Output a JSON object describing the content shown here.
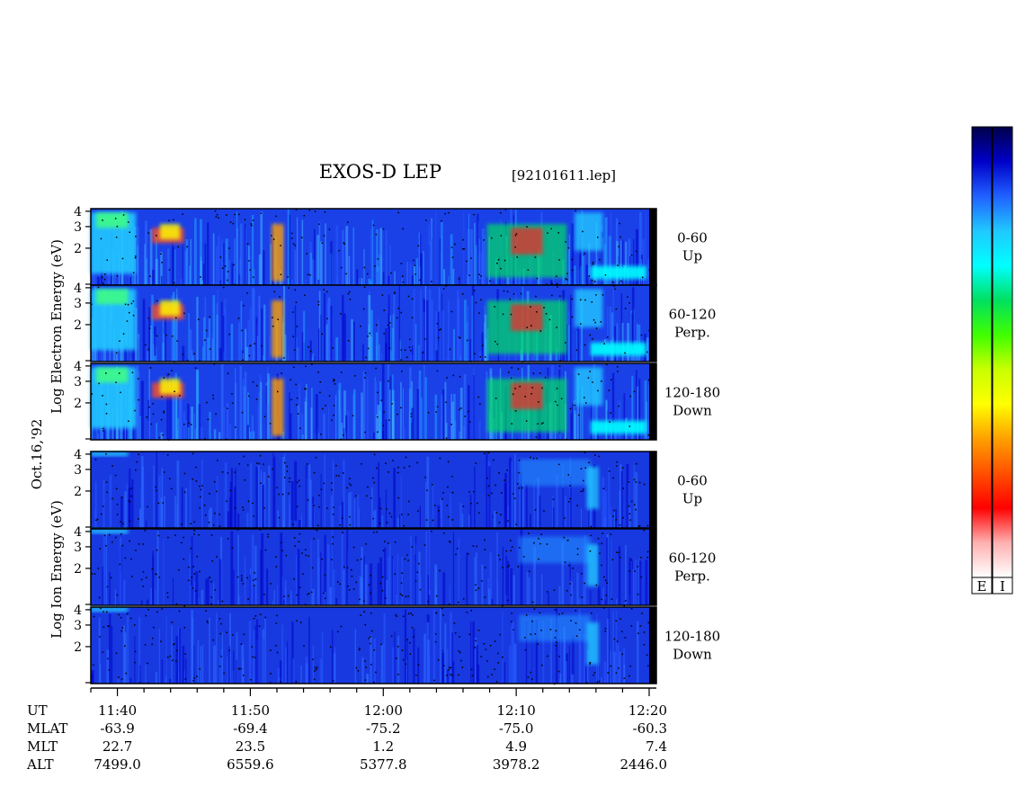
{
  "header": {
    "title": "EXOS-D LEP",
    "file_id": "[92101611.lep]"
  },
  "date_label": "Oct.16,'92",
  "chart_data": {
    "type": "heatmap",
    "x_axis": {
      "quantity": "UT",
      "range": [
        "11:38",
        "12:20"
      ],
      "tick_labels": [
        "11:40",
        "11:50",
        "12:00",
        "12:10",
        "12:20"
      ],
      "minor_tick_interval_min": 2
    },
    "y_axis": {
      "scale": "log",
      "tick_labels": [
        "2",
        "3",
        "4"
      ],
      "range": [
        1,
        4.2
      ]
    },
    "groups": [
      {
        "id": "electron",
        "ylabel": "Log Electron Energy (eV)",
        "panels": [
          {
            "label_line1": "0-60",
            "label_line2": "Up"
          },
          {
            "label_line1": "60-120",
            "label_line2": "Perp."
          },
          {
            "label_line1": "120-180",
            "label_line2": "Down"
          }
        ]
      },
      {
        "id": "ion",
        "ylabel": "Log Ion Energy (eV)",
        "panels": [
          {
            "label_line1": "0-60",
            "label_line2": "Up"
          },
          {
            "label_line1": "60-120",
            "label_line2": "Perp."
          },
          {
            "label_line1": "120-180",
            "label_line2": "Down"
          }
        ]
      }
    ],
    "ephemeris": {
      "rows": [
        {
          "name": "UT",
          "values": [
            "11:40",
            "11:50",
            "12:00",
            "12:10",
            "12:20"
          ]
        },
        {
          "name": "MLAT",
          "values": [
            "-63.9",
            "-69.4",
            "-75.2",
            "-75.0",
            "-60.3"
          ]
        },
        {
          "name": "MLT",
          "values": [
            "22.7",
            "23.5",
            "1.2",
            "4.9",
            "7.4"
          ]
        },
        {
          "name": "ALT",
          "values": [
            "7499.0",
            "6559.6",
            "5377.8",
            "3978.2",
            "2446.0"
          ]
        }
      ]
    },
    "colorbars": [
      {
        "label": "E",
        "colors": [
          "#00004a",
          "#0000c8",
          "#2060ff",
          "#20c8ff",
          "#00ffff",
          "#00e060",
          "#40ff00",
          "#c8ff00",
          "#ffff00",
          "#ffa000",
          "#ff5000",
          "#ff0000",
          "#ffb0b0",
          "#ffffff"
        ]
      },
      {
        "label": "I",
        "colors": [
          "#00004a",
          "#0000c8",
          "#2060ff",
          "#20c8ff",
          "#00ffff",
          "#00e060",
          "#40ff00",
          "#c8ff00",
          "#ffff00",
          "#ffa000",
          "#ff5000",
          "#ff0000",
          "#ffb0b0",
          "#ffffff"
        ]
      }
    ]
  }
}
